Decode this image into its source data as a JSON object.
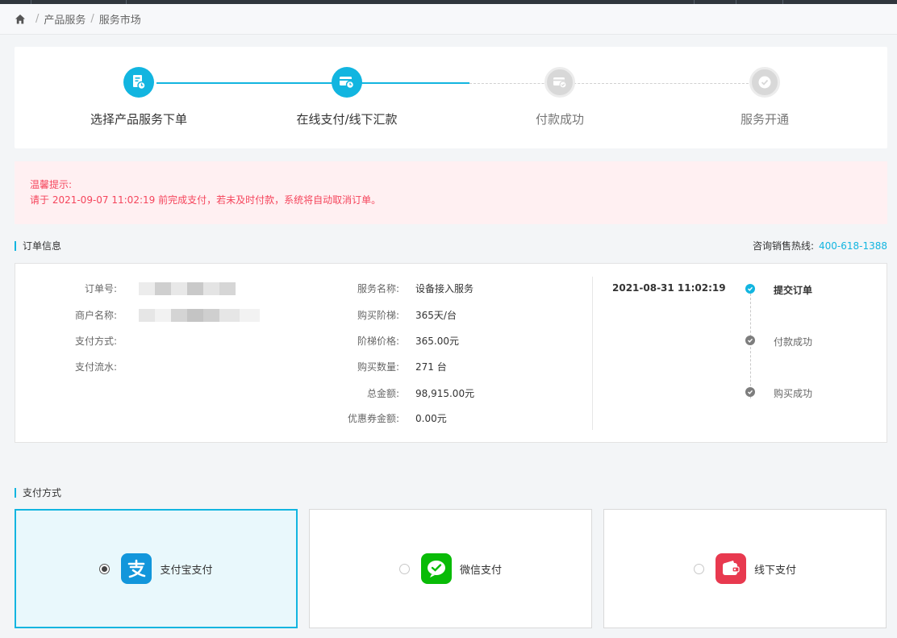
{
  "breadcrumb": {
    "items": [
      "产品服务",
      "服务市场"
    ]
  },
  "steps": [
    {
      "label": "选择产品服务下单",
      "state": "done"
    },
    {
      "label": "在线支付/线下汇款",
      "state": "current"
    },
    {
      "label": "付款成功",
      "state": "pending"
    },
    {
      "label": "服务开通",
      "state": "pending"
    }
  ],
  "notice": {
    "title": "温馨提示:",
    "text": "请于 2021-09-07 11:02:19 前完成支付，若未及时付款，系统将自动取消订单。"
  },
  "order_section": {
    "title": "订单信息"
  },
  "hotline": {
    "label": "咨询销售热线:",
    "number": "400-618-1388"
  },
  "order": {
    "left": [
      {
        "key": "订单号:",
        "value": ""
      },
      {
        "key": "商户名称:",
        "value": ""
      },
      {
        "key": "支付方式:",
        "value": ""
      },
      {
        "key": "支付流水:",
        "value": ""
      }
    ],
    "middle": [
      {
        "key": "服务名称:",
        "value": "设备接入服务"
      },
      {
        "key": "购买阶梯:",
        "value": "365天/台"
      },
      {
        "key": "阶梯价格:",
        "value": "365.00元"
      },
      {
        "key": "购买数量:",
        "value": "271 台"
      },
      {
        "key": "总金额:",
        "value": "98,915.00元"
      },
      {
        "key": "优惠券金额:",
        "value": "0.00元"
      }
    ],
    "timeline": {
      "time": "2021-08-31 11:02:19",
      "events": [
        {
          "label": "提交订单",
          "active": true
        },
        {
          "label": "付款成功",
          "active": false
        },
        {
          "label": "购买成功",
          "active": false
        }
      ]
    }
  },
  "payment_section": {
    "title": "支付方式"
  },
  "payment_methods": [
    {
      "name": "支付宝支付",
      "icon": "alipay-icon",
      "selected": true,
      "color": "#1296db"
    },
    {
      "name": "微信支付",
      "icon": "wechat-pay-icon",
      "selected": false,
      "color": "#09bb07"
    },
    {
      "name": "线下支付",
      "icon": "wallet-icon",
      "selected": false,
      "color": "#e8394f"
    }
  ],
  "colors": {
    "accent": "#12b5e0",
    "warning": "#f5455c"
  }
}
